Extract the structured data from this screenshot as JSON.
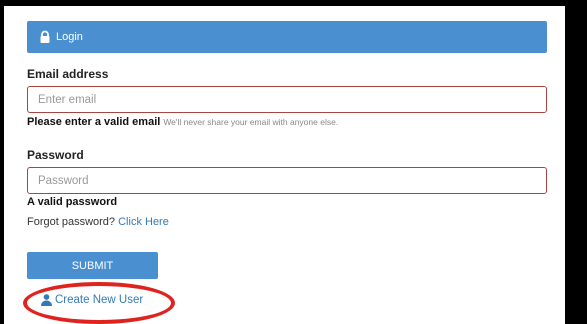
{
  "header": {
    "title": "Login",
    "icon": "lock-icon"
  },
  "email": {
    "label": "Email address",
    "placeholder": "Enter email",
    "value": "",
    "error": "Please enter a valid email",
    "help": "We'll never share your email with anyone else."
  },
  "password": {
    "label": "Password",
    "placeholder": "Password",
    "value": "",
    "error": "A valid password"
  },
  "forgot": {
    "text": "Forgot password?",
    "link": "Click Here"
  },
  "submit_label": "SUBMIT",
  "create_user": {
    "label": "Create New User",
    "icon": "user-icon"
  },
  "colors": {
    "primary": "#4a8fd0",
    "error_border": "#a94442",
    "link": "#337ab7",
    "highlight": "#e0231e"
  }
}
